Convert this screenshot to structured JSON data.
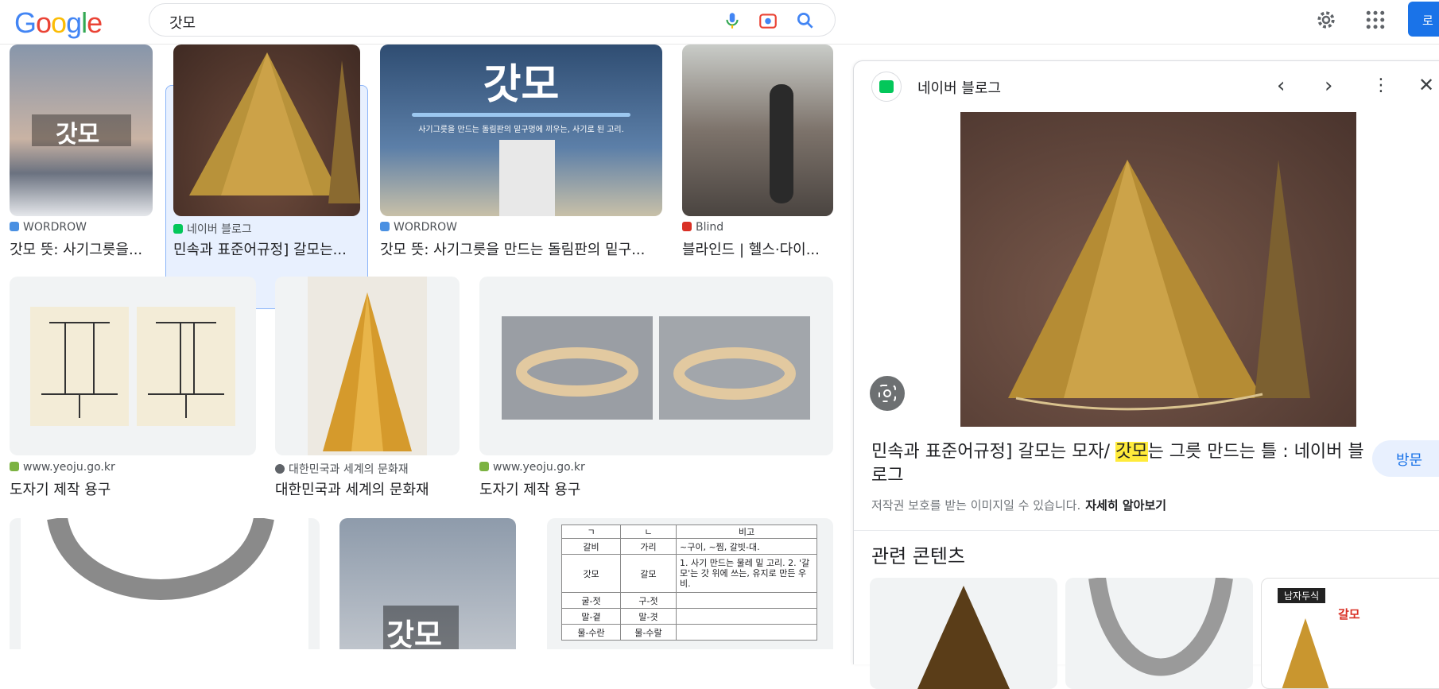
{
  "header": {
    "logo": [
      "G",
      "o",
      "o",
      "g",
      "l",
      "e"
    ],
    "query": "갓모",
    "login_label": "로"
  },
  "grid": {
    "row1": [
      {
        "source": "WORDROW",
        "title": "갓모 뜻: 사기그릇을...",
        "image_text": "갓모"
      },
      {
        "source": "네이버 블로그",
        "title": "민속과 표준어규정] 갈모는..."
      },
      {
        "source": "WORDROW",
        "title": "갓모 뜻: 사기그릇을 만드는 돌림판의 밑구...",
        "image_text": "갓모",
        "image_caption": "사기그릇을 만드는 돌림판의 밑구멍에 끼우는, 사기로 된 고리."
      },
      {
        "source": "Blind",
        "title": "블라인드 | 헬스·다이..."
      }
    ],
    "row2": [
      {
        "source": "www.yeoju.go.kr",
        "title": "도자기 제작 용구"
      },
      {
        "source": "대한민국과 세계의 문화재",
        "title": "대한민국과 세계의 문화재"
      },
      {
        "source": "www.yeoju.go.kr",
        "title": "도자기 제작 용구"
      }
    ],
    "row3_image_text": "갓모",
    "table": {
      "headers": [
        "ㄱ",
        "ㄴ",
        "비고"
      ],
      "rows": [
        [
          "갈비",
          "가리",
          "~구이, ~찜, 갈빗-대."
        ],
        [
          "갓모",
          "갈모",
          "1. 사기 만드는 물레 밑 고리. 2. '갈모'는 갓 위에 쓰는, 유지로 만든 우비."
        ],
        [
          "굴-젓",
          "구-젓",
          ""
        ],
        [
          "말-곁",
          "말-겻",
          ""
        ],
        [
          "물-수란",
          "물-수랄",
          ""
        ]
      ]
    }
  },
  "panel": {
    "site": "네이버 블로그",
    "title_before": "민속과 표준어규정] 갈모는 모자/ ",
    "title_highlight": "갓모",
    "title_after": "는 그릇 만드는 틀 : 네이버 블로그",
    "visit_label": "방문",
    "copyright_note": "저작권 보호를 받는 이미지일 수 있습니다.",
    "learn_more": "자세히 알아보기",
    "related_heading": "관련 콘텐츠",
    "related_third_label": "남자두식",
    "related_third_title": "갈모"
  },
  "colors": {
    "accent_blue": "#1a73e8",
    "naver_green": "#03c75a",
    "highlight": "#ffeb3b"
  }
}
